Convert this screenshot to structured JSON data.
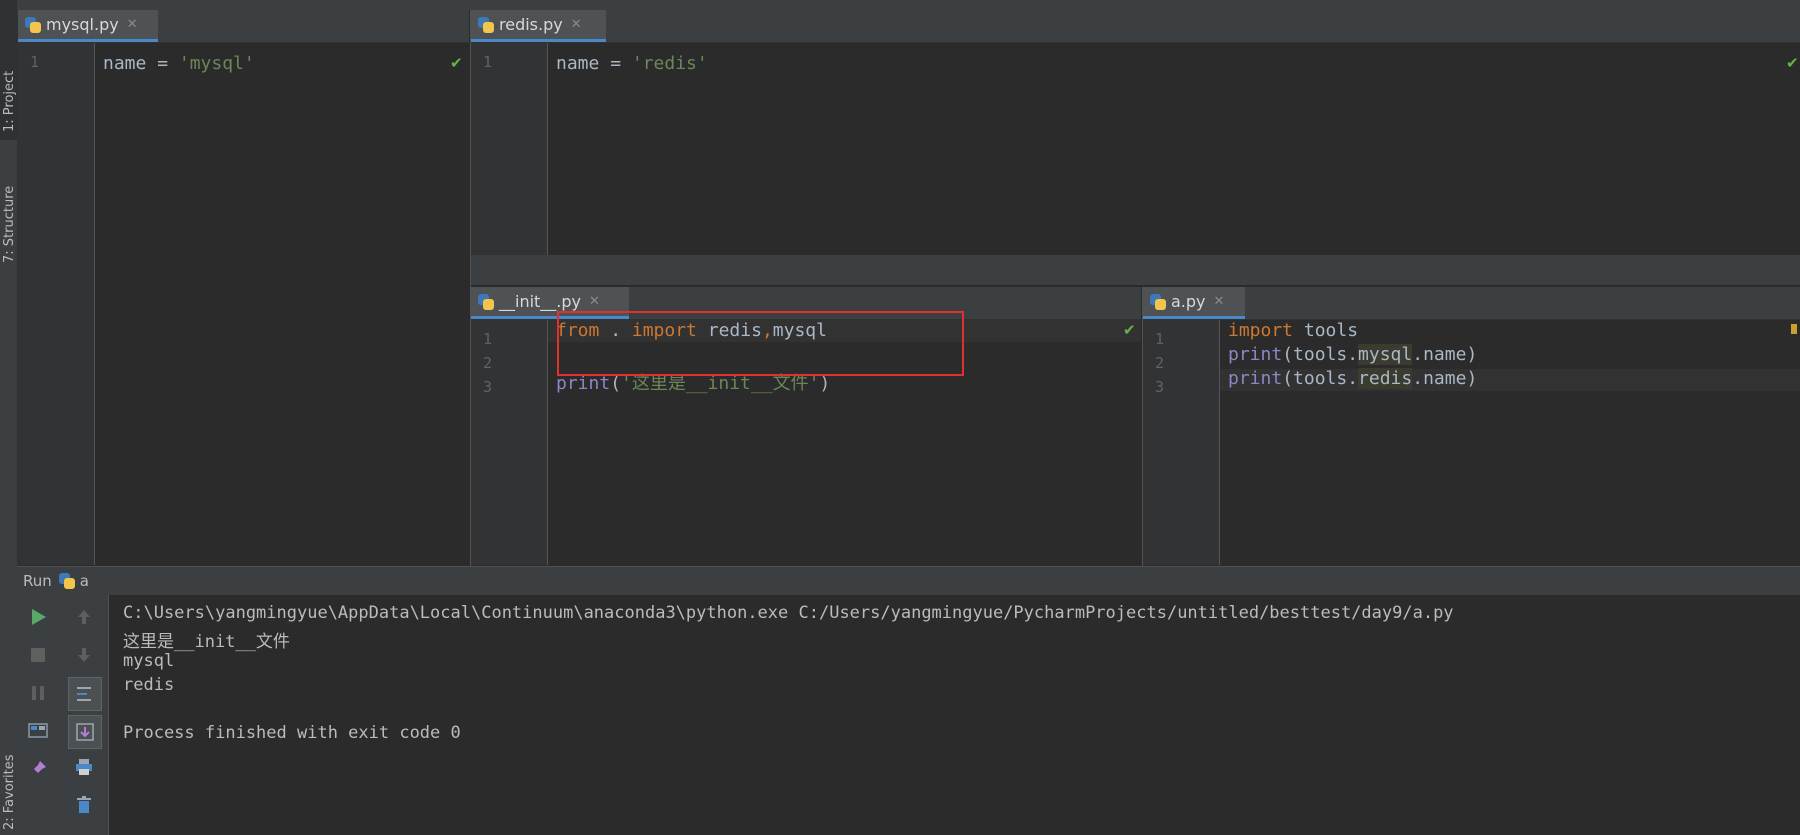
{
  "sidebar": {
    "project_tab": "1: Project",
    "structure_tab": "7: Structure",
    "favorites_tab": "2: Favorites"
  },
  "editors": {
    "mysql_pane": {
      "tab_label": "mysql.py",
      "line_numbers": [
        "1"
      ],
      "code": {
        "l1_var": "name",
        "l1_op": " = ",
        "l1_str": "'mysql'"
      }
    },
    "redis_pane": {
      "tab_label": "redis.py",
      "line_numbers": [
        "1"
      ],
      "code": {
        "l1_var": "name",
        "l1_op": " = ",
        "l1_str": "'redis'"
      }
    },
    "init_pane": {
      "tab_label": "__init__.py",
      "line_numbers": [
        "1",
        "2",
        "3"
      ],
      "code": {
        "l1_from": "from",
        "l1_dot": " . ",
        "l1_import": "import",
        "l1_mods": " redis",
        "l1_comma": ",",
        "l1_mod2": "mysql",
        "l3_print": "print",
        "l3_open": "(",
        "l3_str": "'这里是__init__文件'",
        "l3_close": ")"
      }
    },
    "a_pane": {
      "tab_label": "a.py",
      "line_numbers": [
        "1",
        "2",
        "3"
      ],
      "code": {
        "l1_import": "import",
        "l1_mod": " tools",
        "l2_print": "print",
        "l2_a": "(tools.",
        "l2_b": "mysql",
        "l2_c": ".",
        "l2_d": "name",
        "l2_e": ")",
        "l3_print": "print",
        "l3_a": "(tools.",
        "l3_b": "redis",
        "l3_c": ".",
        "l3_d": "name",
        "l3_e": ")"
      }
    }
  },
  "run_panel": {
    "title": "Run",
    "config_name": "a",
    "output_lines": [
      "C:\\Users\\yangmingyue\\AppData\\Local\\Continuum\\anaconda3\\python.exe C:/Users/yangmingyue/PycharmProjects/untitled/besttest/day9/a.py",
      "这里是__init__文件",
      "mysql",
      "redis",
      "",
      "Process finished with exit code 0"
    ]
  },
  "icons": {
    "run": "play-icon",
    "stop": "stop-icon",
    "pause": "pause-icon",
    "up": "arrow-up-icon",
    "down": "arrow-down-icon",
    "soft_wrap": "soft-wrap-icon",
    "scroll_end": "scroll-to-end-icon",
    "print": "print-icon",
    "clear": "trash-icon",
    "layout": "layout-icon",
    "pin": "pin-icon"
  },
  "colors": {
    "accent": "#4a88c7",
    "annotation": "#e0302f",
    "keyword": "#cc7832",
    "string": "#6a8759",
    "ok_check": "#62b543",
    "run_green": "#59a869"
  }
}
